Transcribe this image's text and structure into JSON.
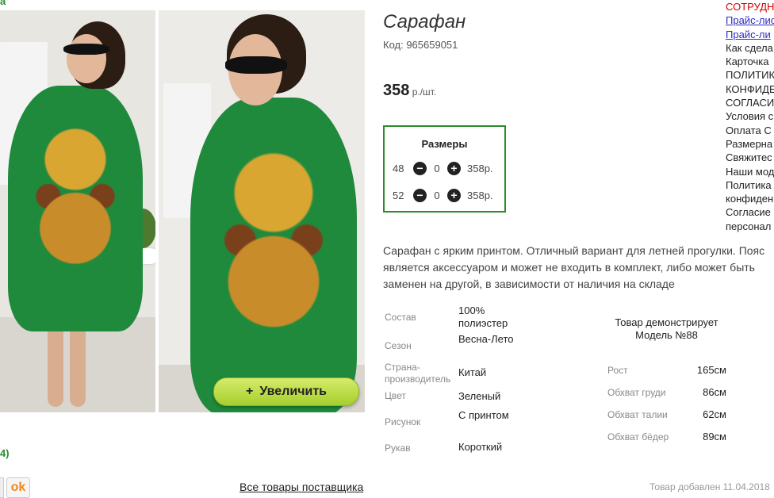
{
  "product": {
    "title": "Сарафан",
    "code": "Код: 965659051",
    "price": "358",
    "price_unit": " р./шт.",
    "zoom_label": "Увеличить",
    "zoom_plus": "+",
    "description_lines": [
      "Сарафан с ярким принтом. Отличный вариант для летней прогулки. Пояс",
      "является аксессуаром и может не входить в комплект, либо может быть",
      "заменен на другой, в зависимости от наличия на складе"
    ]
  },
  "sizes": {
    "title": "Размеры",
    "rows": [
      {
        "size": "48",
        "minus": "−",
        "qty": "0",
        "plus": "+",
        "price": "358р."
      },
      {
        "size": "52",
        "minus": "−",
        "qty": "0",
        "plus": "+",
        "price": "358р."
      }
    ]
  },
  "attributes": [
    {
      "key": "Состав",
      "value": "100% полиэстер"
    },
    {
      "key": "Сезон",
      "value": "Весна-Лето"
    },
    {
      "key": "Страна-производитель",
      "value": "Китай"
    },
    {
      "key": "Цвет",
      "value": "Зеленый"
    },
    {
      "key": "Рисунок",
      "value": "С принтом"
    },
    {
      "key": "Рукав",
      "value": "Короткий"
    }
  ],
  "model": {
    "title": "Товар демонстрирует Модель №88",
    "measurements": [
      {
        "key": "Рост",
        "value": "165см"
      },
      {
        "key": "Обхват груди",
        "value": "86см"
      },
      {
        "key": "Обхват талии",
        "value": "62см"
      },
      {
        "key": "Обхват бёдер",
        "value": "89см"
      }
    ]
  },
  "right_links": [
    {
      "text": "СОТРУДН",
      "style": "red"
    },
    {
      "text": "Прайс-лис",
      "style": "blue"
    },
    {
      "text": "Прайс-ли",
      "style": "blue"
    },
    {
      "text": "Как сдела",
      "style": "plain"
    },
    {
      "text": "Карточка",
      "style": "plain"
    },
    {
      "text": "ПОЛИТИК",
      "style": "plain"
    },
    {
      "text": "КОНФИДЕ",
      "style": "plain"
    },
    {
      "text": "СОГЛАСИ",
      "style": "plain"
    },
    {
      "text": "Условия с",
      "style": "plain"
    },
    {
      "text": "Оплата С",
      "style": "plain"
    },
    {
      "text": "Размерна",
      "style": "plain"
    },
    {
      "text": "Свяжитес",
      "style": "plain"
    },
    {
      "text": "Наши мод",
      "style": "plain"
    },
    {
      "text": "Политика",
      "style": "plain"
    },
    {
      "text": "конфиден",
      "style": "plain"
    },
    {
      "text": "Согласие",
      "style": "plain"
    },
    {
      "text": "персонал",
      "style": "plain"
    }
  ],
  "left_fragments": {
    "top": "а",
    "bottom": "4)"
  },
  "social": {
    "ok_icon": "odnoklassniki-icon",
    "ok_glyph": "ok"
  },
  "footer": {
    "all_goods": "Все товары поставщика",
    "added": "Товар добавлен 11.04.2018"
  },
  "colors": {
    "accent_green": "#2a8c2a",
    "dress_green": "#1f8a3c",
    "link_red": "#d00000",
    "link_blue": "#2a2acc",
    "zoom_button": "#b8dd44"
  }
}
